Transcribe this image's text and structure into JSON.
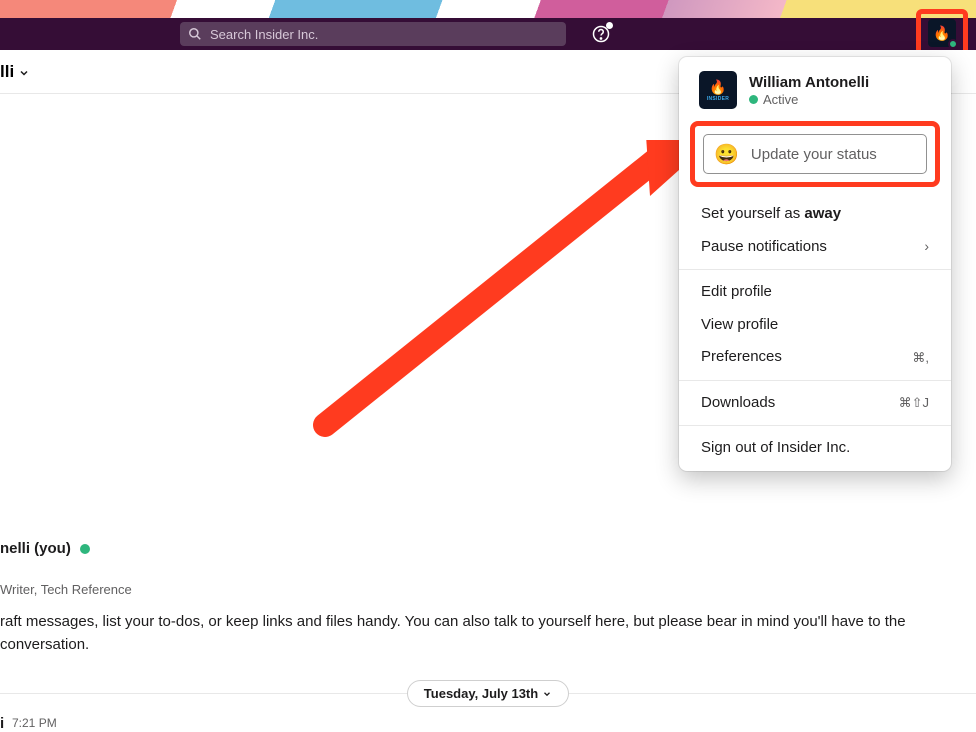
{
  "header": {
    "search_placeholder": "Search Insider Inc."
  },
  "channel": {
    "name_suffix": "lli"
  },
  "profile_menu": {
    "user_name": "William Antonelli",
    "status_text": "Active",
    "update_status_placeholder": "Update your status",
    "set_away_prefix": "Set yourself as ",
    "set_away_word": "away",
    "pause_notifications": "Pause notifications",
    "edit_profile": "Edit profile",
    "view_profile": "View profile",
    "preferences": "Preferences",
    "preferences_shortcut": "⌘,",
    "downloads": "Downloads",
    "downloads_shortcut": "⌘⇧J",
    "sign_out": "Sign out of Insider Inc."
  },
  "dm": {
    "name": "nelli (you)",
    "title": "Writer, Tech Reference",
    "description": "raft messages, list your to-dos, or keep links and files handy. You can also talk to yourself here, but please bear in mind you'll have to the conversation.",
    "date_label": "Tuesday, July 13th",
    "msg_author": "i",
    "msg_time": "7:21 PM"
  }
}
